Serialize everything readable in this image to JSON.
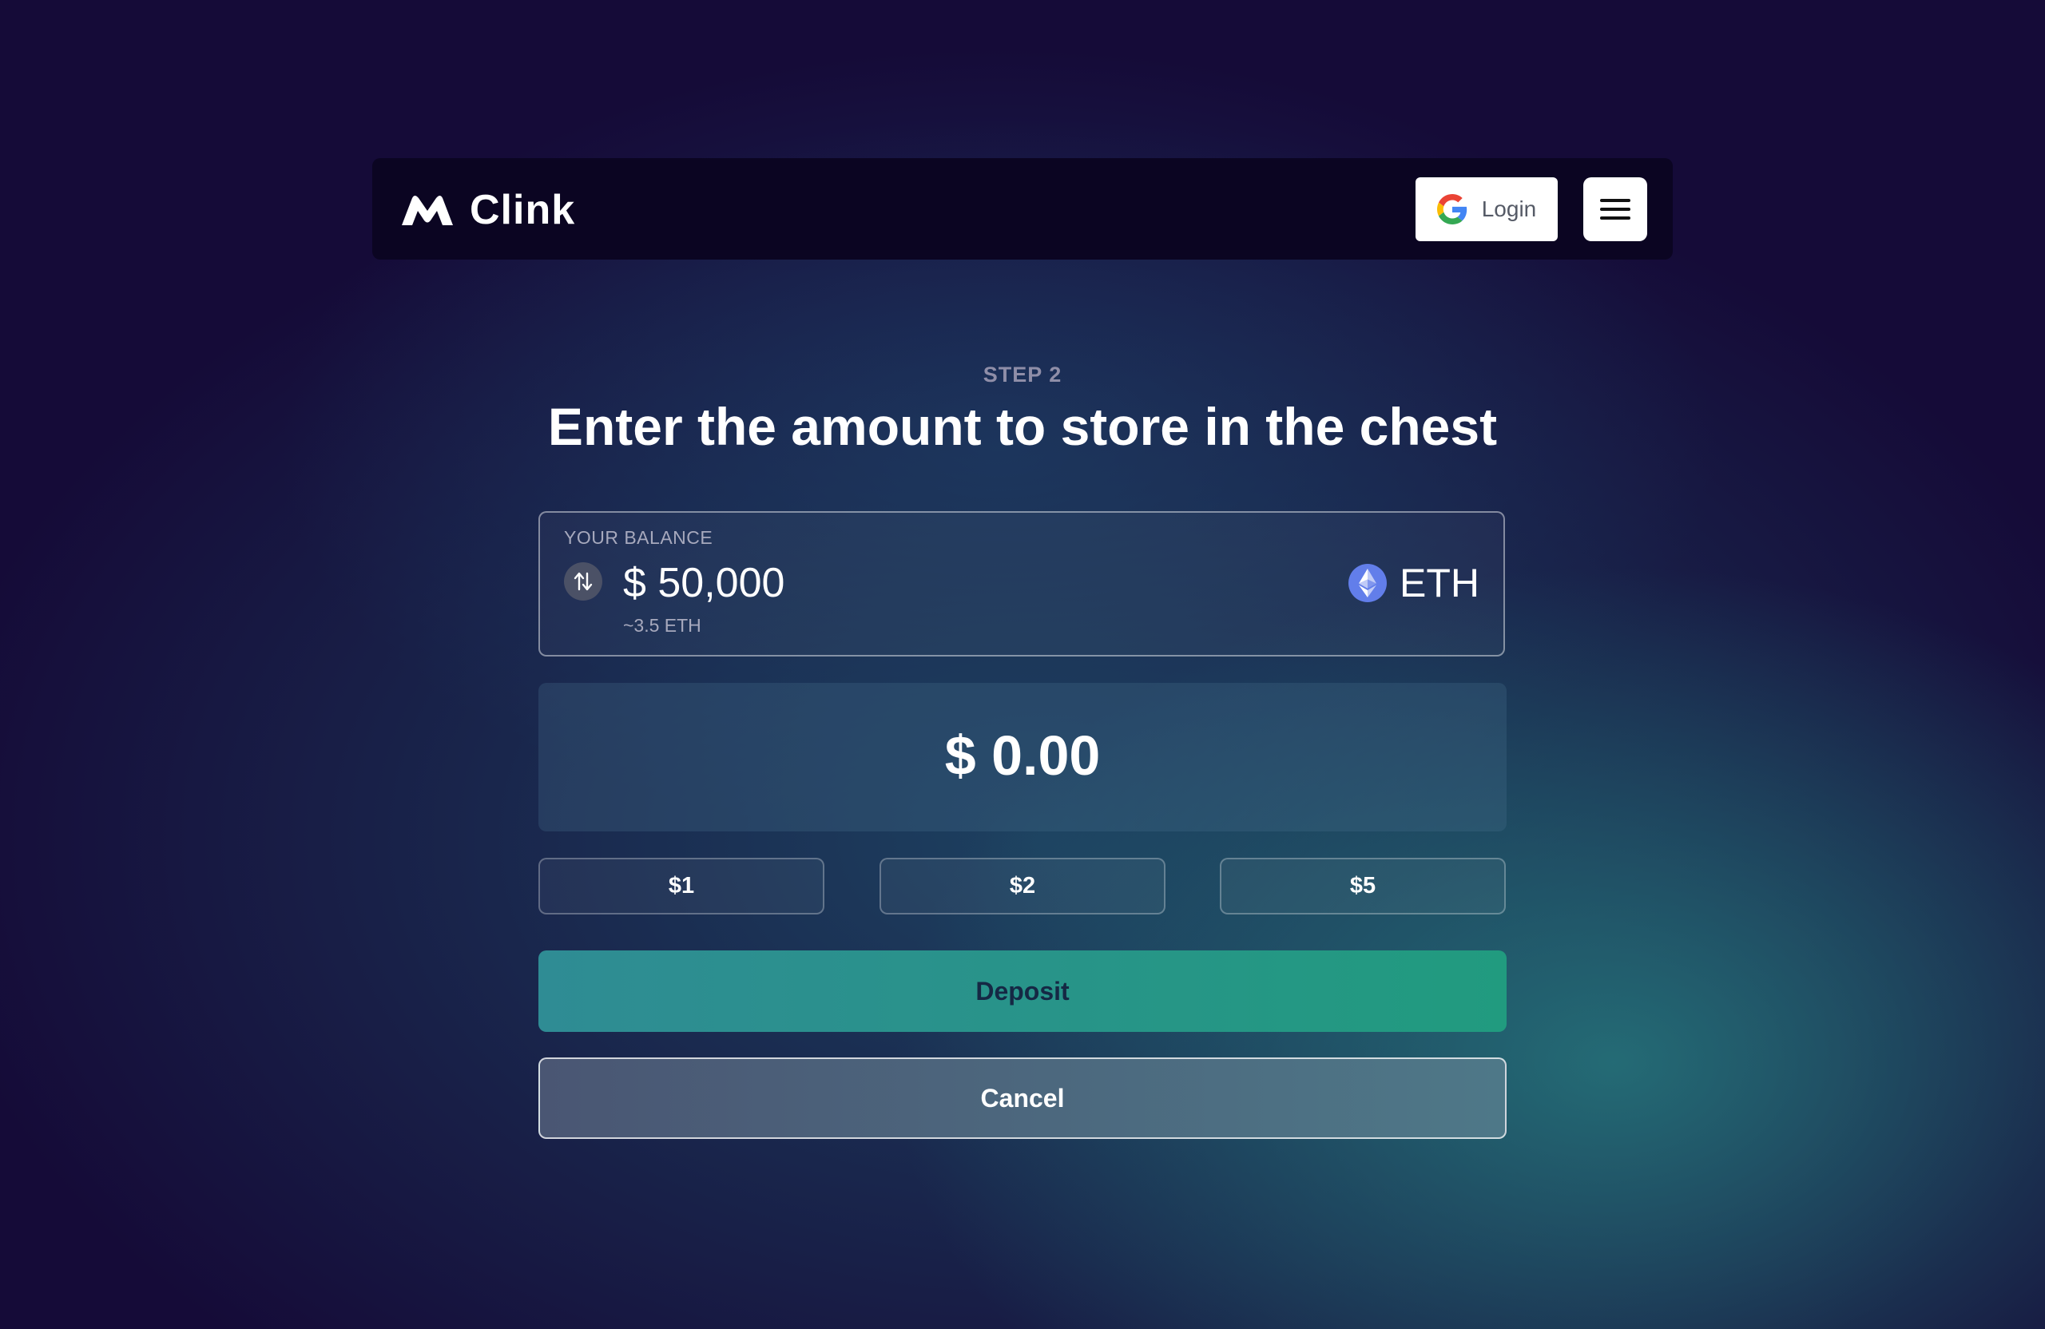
{
  "header": {
    "brand_name": "Clink",
    "login_label": "Login",
    "login_icon": "google-icon",
    "menu_icon": "hamburger-menu-icon"
  },
  "main": {
    "step_label": "STEP 2",
    "headline": "Enter the amount to store in the chest",
    "balance": {
      "label": "YOUR BALANCE",
      "amount": "$ 50,000",
      "eth_equivalent": "~3.5 ETH",
      "currency": "ETH",
      "currency_icon": "ethereum-icon",
      "swap_icon": "swap-arrows-icon"
    },
    "amount_input": {
      "value": "$ 0.00"
    },
    "quick_amounts": [
      "$1",
      "$2",
      "$5"
    ],
    "deposit_label": "Deposit",
    "cancel_label": "Cancel"
  },
  "colors": {
    "background": "#150b38",
    "navbar": "#0b0522",
    "deposit_gradient_start": "#2f8c94",
    "deposit_gradient_end": "#219b7f",
    "eth_blue": "#627eea"
  }
}
